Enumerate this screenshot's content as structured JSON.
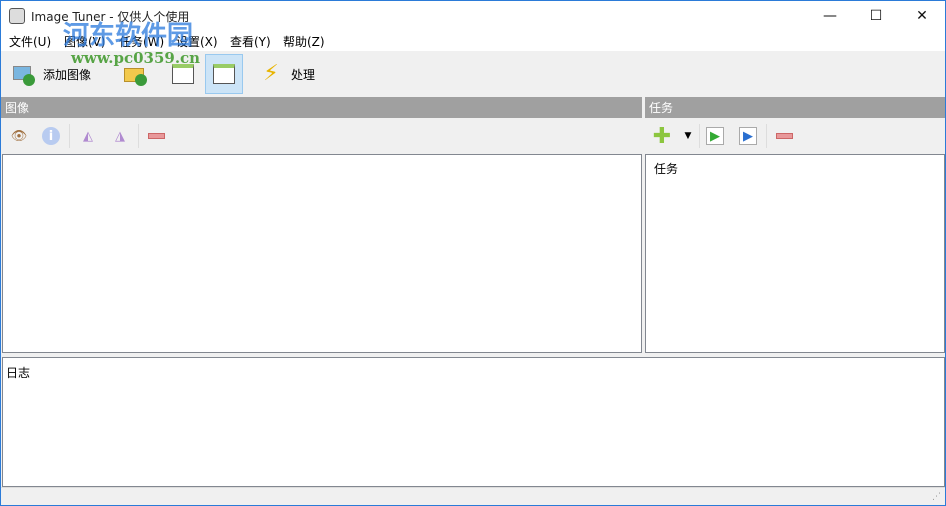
{
  "window": {
    "title": "Image Tuner - 仅供人个使用",
    "minimize": "—",
    "maximize": "☐",
    "close": "✕"
  },
  "menu": [
    "文件(U)",
    "图像(V)",
    "任务(W)",
    "设置(X)",
    "查看(Y)",
    "帮助(Z)"
  ],
  "toolbar": {
    "add_images": "添加图像",
    "process": "处理"
  },
  "images_panel": {
    "header": "图像"
  },
  "tasks_panel": {
    "header": "任务",
    "list_header": "任务"
  },
  "log_panel": {
    "label": "日志"
  },
  "watermark": {
    "line1": "河东软件园",
    "line2": "www.pc0359.cn"
  }
}
